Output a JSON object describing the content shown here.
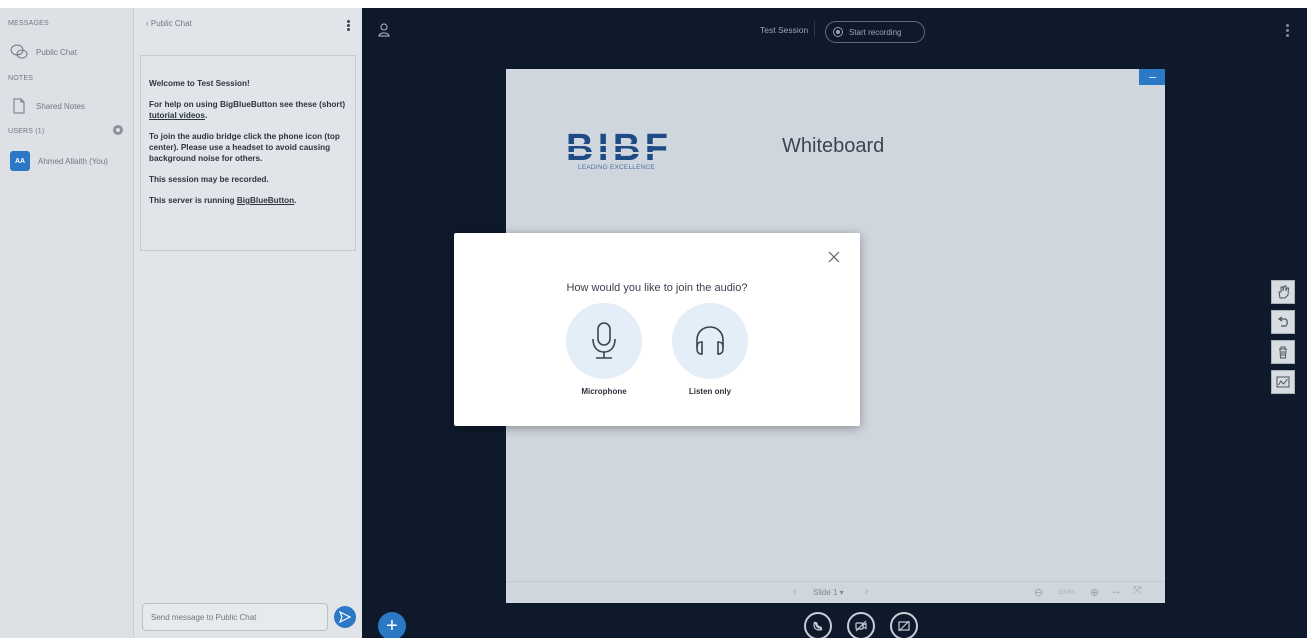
{
  "sidebar": {
    "messages_title": "MESSAGES",
    "public_chat_label": "Public Chat",
    "notes_title": "NOTES",
    "shared_notes_label": "Shared Notes",
    "users_title": "USERS (1)",
    "user_initials": "AA",
    "user_name": "Ahmed Allaith (You)"
  },
  "chat": {
    "header_label": "‹  Public Chat",
    "welcome_title": "Welcome to Test Session!",
    "help_prefix": "For help on using BigBlueButton see these (short) ",
    "help_link": "tutorial videos",
    "help_suffix": ".",
    "audio_text": "To join the audio bridge click the phone icon (top center). Please use a headset to avoid causing background noise for others.",
    "recorded_text": "This session may be recorded.",
    "server_prefix": "This server is running ",
    "server_link": "BigBlueButton",
    "server_suffix": ".",
    "input_placeholder": "Send message to Public Chat"
  },
  "topbar": {
    "session_title": "Test Session",
    "record_label": "Start recording"
  },
  "presentation": {
    "logo_text": "BIBF",
    "logo_tagline": "LEADING EXCELLENCE",
    "slide_title": "Whiteboard",
    "slide_selector": "Slide 1  ▾",
    "zoom_level": "100%"
  },
  "audio_modal": {
    "title": "How would you like to join the audio?",
    "microphone_label": "Microphone",
    "listen_only_label": "Listen only"
  },
  "colors": {
    "accent": "#2b78c4",
    "dark_bg": "#0e1a2b",
    "panel_bg": "#e1e5e9"
  }
}
